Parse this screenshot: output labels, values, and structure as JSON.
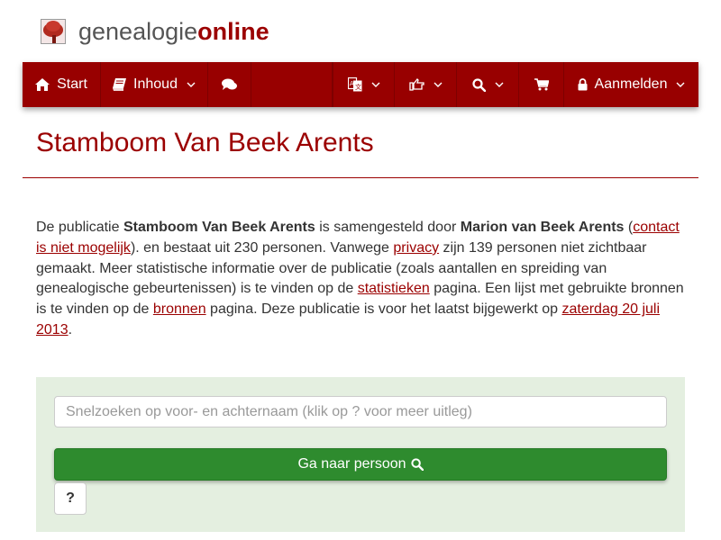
{
  "logo": {
    "part1": "genealogie",
    "part2": "online"
  },
  "nav": {
    "start": "Start",
    "inhoud": "Inhoud",
    "login": "Aanmelden",
    "icons": {
      "start": "home-icon",
      "inhoud": "book-icon",
      "chat": "comments-icon",
      "lang": "translate-icon",
      "share": "share-icon",
      "search": "search-icon",
      "cart": "cart-icon",
      "login": "lock-icon"
    }
  },
  "page": {
    "title": "Stamboom Van Beek Arents"
  },
  "intro": {
    "t1": "De publicatie ",
    "pub": "Stamboom Van Beek Arents",
    "t2": " is samengesteld door ",
    "author": "Marion van Beek Arents",
    "t3": " (",
    "contact_link": "contact is niet mogelijk",
    "t4": "). en bestaat uit 230 personen. Vanwege ",
    "privacy_link": "privacy",
    "t5": " zijn 139 personen niet zichtbaar gemaakt. Meer statistische informatie over de publicatie (zoals aantallen en spreiding van genealogische gebeurtenissen) is te vinden op de ",
    "stats_link": "statistieken",
    "t6": " pagina. Een lijst met gebruikte bronnen is te vinden op de ",
    "sources_link": "bronnen",
    "t7": " pagina. Deze publicatie is voor het laatst bijgewerkt op ",
    "date_link": "zaterdag 20 juli 2013",
    "t8": "."
  },
  "search": {
    "placeholder": "Snelzoeken op voor- en achternaam (klik op ? voor meer uitleg)",
    "value": "",
    "go_label": "Ga naar persoon",
    "help_label": "?"
  },
  "colors": {
    "brand": "#9b0000",
    "nav_bg": "#980000",
    "panel_bg": "#e4efe0",
    "button_green": "#2e8b2e"
  }
}
